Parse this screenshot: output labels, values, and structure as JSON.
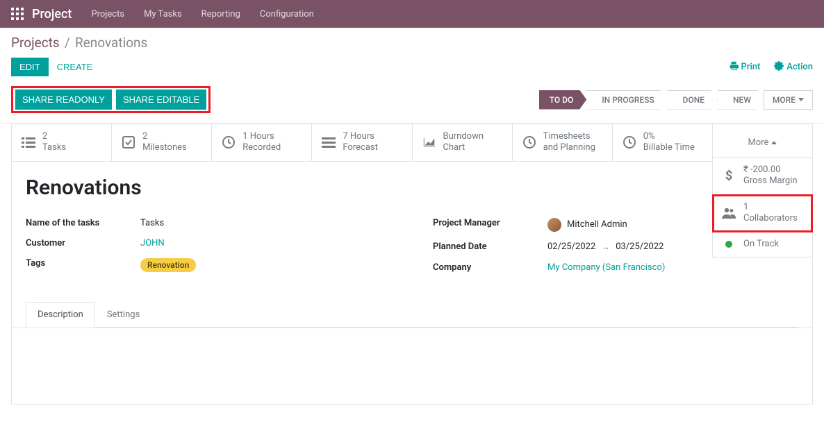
{
  "navbar": {
    "brand": "Project",
    "items": [
      "Projects",
      "My Tasks",
      "Reporting",
      "Configuration"
    ]
  },
  "breadcrumb": {
    "parent": "Projects",
    "sep": "/",
    "current": "Renovations"
  },
  "toolbar": {
    "edit": "EDIT",
    "create": "CREATE",
    "print": "Print",
    "action": "Action"
  },
  "share": {
    "readonly": "SHARE READONLY",
    "editable": "SHARE EDITABLE"
  },
  "stages": {
    "todo": "TO DO",
    "in_progress": "IN PROGRESS",
    "done": "DONE",
    "new": "NEW",
    "more": "MORE"
  },
  "statcards": {
    "tasks": {
      "value": "2",
      "label": "Tasks"
    },
    "milestones": {
      "value": "2",
      "label": "Milestones"
    },
    "recorded": {
      "value": "1 Hours",
      "label": "Recorded"
    },
    "forecast": {
      "value": "7 Hours",
      "label": "Forecast"
    },
    "burndown": {
      "value": "Burndown",
      "label": "Chart"
    },
    "timesheets": {
      "value": "Timesheets",
      "label": "and Planning"
    },
    "billable": {
      "value": "0%",
      "label": "Billable Time"
    },
    "more": "More"
  },
  "dropdown": {
    "gross": {
      "value": "₹ -200.00",
      "label": "Gross Margin"
    },
    "collab": {
      "value": "1",
      "label": "Collaborators"
    },
    "ontrack": "On Track"
  },
  "project": {
    "title": "Renovations",
    "fields_left": {
      "tasks_name": {
        "label": "Name of the tasks",
        "value": "Tasks"
      },
      "customer": {
        "label": "Customer",
        "value": "JOHN"
      },
      "tags": {
        "label": "Tags",
        "value": "Renovation"
      }
    },
    "fields_right": {
      "manager": {
        "label": "Project Manager",
        "value": "Mitchell Admin"
      },
      "planned": {
        "label": "Planned Date",
        "start": "02/25/2022",
        "end": "03/25/2022"
      },
      "company": {
        "label": "Company",
        "value": "My Company (San Francisco)"
      }
    }
  },
  "tabs": {
    "description": "Description",
    "settings": "Settings"
  }
}
